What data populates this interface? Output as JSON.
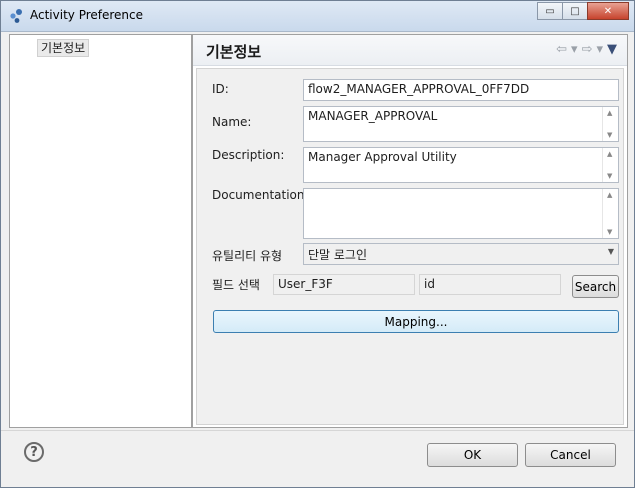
{
  "window": {
    "title": "Activity Preference",
    "minimize": "▭",
    "maximize": "□",
    "close": "✕"
  },
  "tree": {
    "items": [
      {
        "label": "기본정보"
      }
    ]
  },
  "section": {
    "title": "기본정보"
  },
  "nav": {
    "back": "⇦",
    "back_menu": "▾",
    "forward": "⇨",
    "forward_menu": "▾",
    "view_menu": "▼"
  },
  "form": {
    "id_label": "ID:",
    "id_value": "flow2_MANAGER_APPROVAL_0FF7DD",
    "name_label": "Name:",
    "name_value": "MANAGER_APPROVAL",
    "description_label": "Description:",
    "description_value": "Manager Approval Utility",
    "documentation_label": "Documentation:",
    "documentation_value": "",
    "utility_type_label": "유틸리티 유형",
    "utility_type_value": "단말 로그인",
    "field_select_label": "필드 선택",
    "field_select_value1": "User_F3F",
    "field_select_value2": "id",
    "search_label": "Search",
    "mapping_label": "Mapping..."
  },
  "footer": {
    "help": "?",
    "ok_label": "OK",
    "cancel_label": "Cancel"
  },
  "icons": {
    "app": "app-icon",
    "help": "help-icon"
  }
}
